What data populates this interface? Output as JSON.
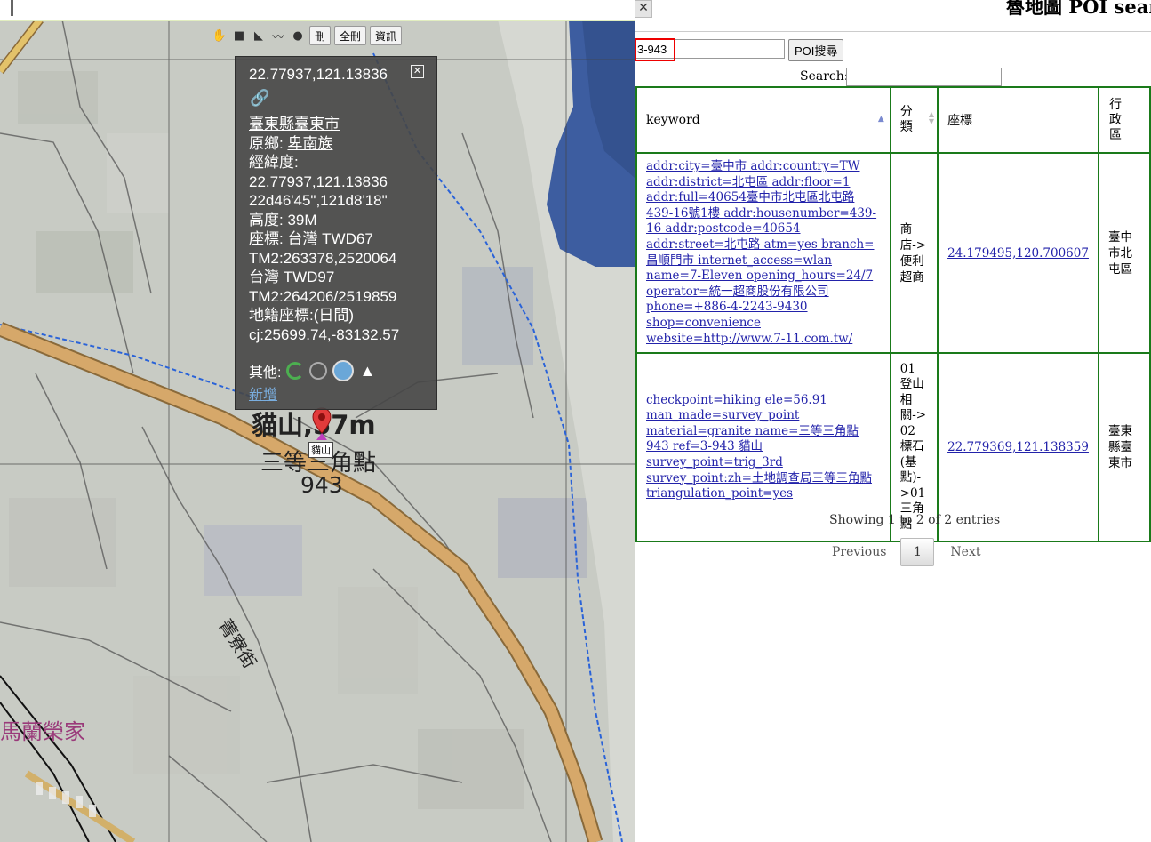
{
  "map": {
    "toolbar": {
      "icons": [
        "hand-icon",
        "square-icon",
        "polygon-icon",
        "polyline-icon",
        "circle-icon"
      ],
      "delete_label": "刪",
      "delete_all_label": "全刪",
      "info_label": "資訊"
    },
    "popup": {
      "title": "22.77937,121.13836",
      "lines": [
        "臺東縣臺東市",
        "原鄉: 卑南族",
        "經緯度:",
        "22.77937,121.13836",
        "22d46'45\",121d8'18\"",
        "高度: 39M",
        "座標: 台灣 TWD67",
        "TM2:263378,2520064",
        "台灣 TWD97",
        "TM2:264206/2519859",
        "地籍座標:(日間)",
        "cj:25699.74,-83132.57"
      ],
      "other_label": "其他:",
      "new_label": "新增"
    },
    "labels": {
      "peak_name": "貓山,57m",
      "point_type": "三等三角點",
      "point_number": "943",
      "marker_tag": "貓山",
      "street": "菁寮街",
      "village": "馬蘭榮家"
    }
  },
  "panel": {
    "title": "魯地圖 POI search",
    "poi_input_value": "3-943",
    "poi_button": "POI搜尋",
    "search_label": "Search:",
    "search_value": "",
    "columns": [
      "keyword",
      "分類",
      "座標",
      "行政區"
    ],
    "rows": [
      {
        "keyword": "addr:city=臺中市 addr:country=TW addr:district=北屯區 addr:floor=1 addr:full=40654臺中市北屯區北屯路439-16號1樓 addr:housenumber=439-16 addr:postcode=40654 addr:street=北屯路 atm=yes branch=昌順門市 internet_access=wlan name=7-Eleven opening_hours=24/7 operator=統一超商股份有限公司 phone=+886-4-2243-9430 shop=convenience website=http://www.7-11.com.tw/",
        "category": "商店->便利超商",
        "coord": "24.179495,120.700607",
        "district": "臺中市北屯區"
      },
      {
        "keyword": "checkpoint=hiking ele=56.91 man_made=survey_point material=granite name=三等三角點 943 ref=3-943 貓山 survey_point=trig_3rd survey_point:zh=土地調查局三等三角點 triangulation_point=yes",
        "category": "01登山相關->02標石(基點)->01三角點",
        "coord": "22.779369,121.138359",
        "district": "臺東縣臺東市"
      }
    ],
    "showing": "Showing 1 to 2 of 2 entries",
    "pagination": {
      "previous": "Previous",
      "page": "1",
      "next": "Next"
    }
  }
}
